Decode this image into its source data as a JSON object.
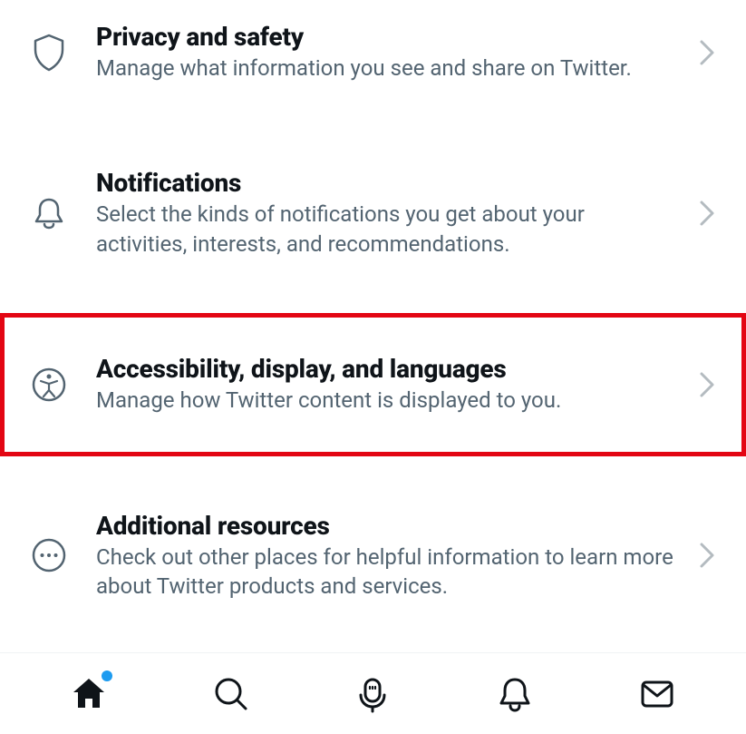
{
  "settings": {
    "items": [
      {
        "title": "Privacy and safety",
        "desc": "Manage what information you see and share on Twitter."
      },
      {
        "title": "Notifications",
        "desc": "Select the kinds of notifications you get about your activities, interests, and recommendations."
      },
      {
        "title": "Accessibility, display, and languages",
        "desc": "Manage how Twitter content is displayed to you."
      },
      {
        "title": "Additional resources",
        "desc": "Check out other places for helpful information to learn more about Twitter products and services."
      }
    ]
  }
}
